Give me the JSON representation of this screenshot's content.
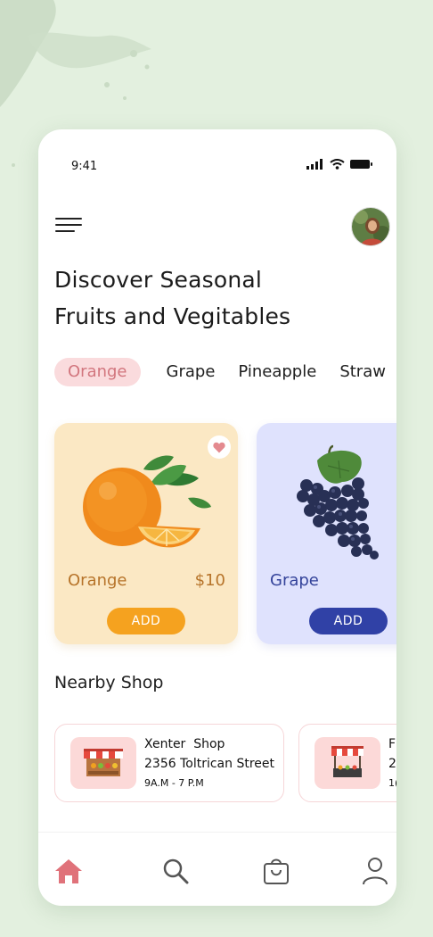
{
  "status_bar": {
    "time": "9:41"
  },
  "header": {
    "title_line1": "Discover Seasonal",
    "title_line2": "Fruits and Vegitables"
  },
  "categories": [
    {
      "label": "Orange",
      "active": true
    },
    {
      "label": "Grape",
      "active": false
    },
    {
      "label": "Pineapple",
      "active": false
    },
    {
      "label": "Straw",
      "active": false
    }
  ],
  "products": [
    {
      "name": "Orange",
      "price": "$10",
      "button": "ADD",
      "favorite": true,
      "bg_color": "#fbe8c4",
      "button_color": "#f5a21f"
    },
    {
      "name": "Grape",
      "button": "ADD",
      "bg_color": "#dfe2fd",
      "button_color": "#3041a6"
    }
  ],
  "nearby": {
    "title": "Nearby Shop",
    "shops": [
      {
        "name": "Xenter  Shop",
        "address": "2356 Toltrican Street",
        "hours": "9A.M - 7 P.M"
      },
      {
        "name": "F",
        "address": "2",
        "hours": "1("
      }
    ]
  },
  "bottom_nav": [
    {
      "icon": "home-icon",
      "active": true
    },
    {
      "icon": "search-icon"
    },
    {
      "icon": "shopping-bag-icon"
    },
    {
      "icon": "profile-icon"
    }
  ],
  "colors": {
    "accent": "#e0727a",
    "background": "#e3f0df"
  }
}
